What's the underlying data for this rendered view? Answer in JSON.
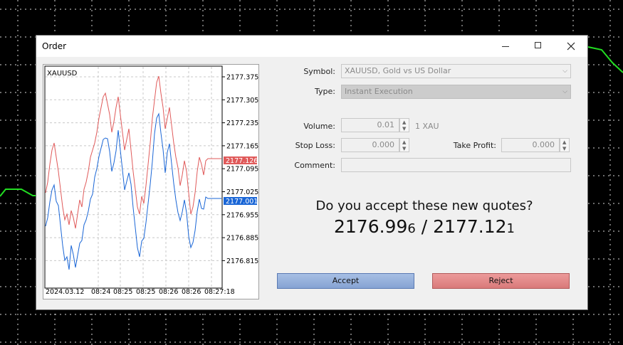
{
  "window": {
    "title": "Order"
  },
  "chart": {
    "symbol": "XAUUSD",
    "price_ticks": [
      "2177.375",
      "2177.305",
      "2177.235",
      "2177.165",
      "2177.095",
      "2177.025",
      "2176.955",
      "2176.885",
      "2176.815"
    ],
    "time_ticks": [
      "2024.03.12",
      "08:24",
      "08:25",
      "08:25",
      "08:26",
      "08:26",
      "08:27:18"
    ],
    "ask_label": "2177.126",
    "bid_label": "2177.001",
    "ask_color": "#e05a5a",
    "bid_color": "#1a66d6"
  },
  "form": {
    "symbol_label": "Symbol:",
    "symbol_value": "XAUUSD, Gold vs US Dollar",
    "type_label": "Type:",
    "type_value": "Instant Execution",
    "volume_label": "Volume:",
    "volume_value": "0.01",
    "volume_unit": "1 XAU",
    "stoploss_label": "Stop Loss:",
    "stoploss_value": "0.000",
    "takeprofit_label": "Take Profit:",
    "takeprofit_value": "0.000",
    "comment_label": "Comment:",
    "comment_value": ""
  },
  "requote": {
    "question": "Do you accept these new quotes?",
    "bid_main": "2176.99",
    "bid_small": "6",
    "separator": " / ",
    "ask_main": "2177.12",
    "ask_small": "1"
  },
  "buttons": {
    "accept": "Accept",
    "reject": "Reject"
  }
}
